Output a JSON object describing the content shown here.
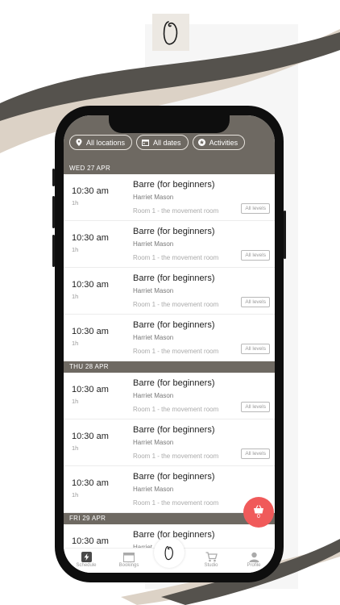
{
  "filters": [
    {
      "label": "All locations",
      "icon": "location-pin-icon"
    },
    {
      "label": "All dates",
      "icon": "calendar-icon"
    },
    {
      "label": "Activities",
      "icon": "star-icon"
    }
  ],
  "days": [
    {
      "date": "WED 27 APR",
      "sessions": [
        {
          "time": "10:30 am",
          "duration": "1h",
          "title": "Barre (for beginners)",
          "teacher": "Harriet Mason",
          "room": "Room 1 - the movement room",
          "level": "All levels"
        },
        {
          "time": "10:30 am",
          "duration": "1h",
          "title": "Barre (for beginners)",
          "teacher": "Harriet Mason",
          "room": "Room 1 - the movement room",
          "level": "All levels"
        },
        {
          "time": "10:30 am",
          "duration": "1h",
          "title": "Barre (for beginners)",
          "teacher": "Harriet Mason",
          "room": "Room 1 - the movement room",
          "level": "All levels"
        },
        {
          "time": "10:30 am",
          "duration": "1h",
          "title": "Barre (for beginners)",
          "teacher": "Harriet Mason",
          "room": "Room 1 - the movement room",
          "level": "All levels"
        }
      ]
    },
    {
      "date": "THU 28 APR",
      "sessions": [
        {
          "time": "10:30 am",
          "duration": "1h",
          "title": "Barre (for beginners)",
          "teacher": "Harriet Mason",
          "room": "Room 1 - the movement room",
          "level": "All levels"
        },
        {
          "time": "10:30 am",
          "duration": "1h",
          "title": "Barre (for beginners)",
          "teacher": "Harriet Mason",
          "room": "Room 1 - the movement room",
          "level": "All levels"
        },
        {
          "time": "10:30 am",
          "duration": "1h",
          "title": "Barre (for beginners)",
          "teacher": "Harriet Mason",
          "room": "Room 1 - the movement room",
          "level": ""
        }
      ]
    },
    {
      "date": "FRI 29 APR",
      "sessions": [
        {
          "time": "10:30 am",
          "duration": "",
          "title": "Barre (for beginners)",
          "teacher": "Harriet",
          "room": "",
          "level": ""
        }
      ]
    }
  ],
  "basket": {
    "count": "0",
    "icon": "basket-icon"
  },
  "tabs": [
    {
      "label": "Schedule",
      "icon": "lightning-icon"
    },
    {
      "label": "Bookings",
      "icon": "calendar-icon"
    },
    {
      "label": "",
      "icon": "logo-icon"
    },
    {
      "label": "Studio",
      "icon": "cart-icon"
    },
    {
      "label": "Profile",
      "icon": "person-icon"
    }
  ],
  "colors": {
    "brand": "#6e6962",
    "accent": "#f05a5a",
    "swoosh_dark": "#55524d",
    "swoosh_light": "#dcd2c6"
  }
}
